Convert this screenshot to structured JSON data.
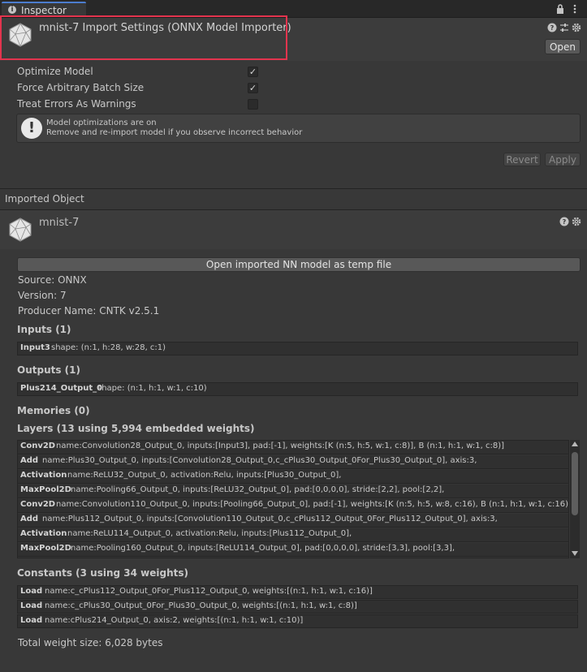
{
  "tab": {
    "label": "Inspector",
    "icon": "info-icon"
  },
  "header": {
    "title": "mnist-7 Import Settings (ONNX Model Importer)",
    "open_label": "Open"
  },
  "settings": [
    {
      "label": "Optimize Model",
      "checked": true
    },
    {
      "label": "Force Arbitrary Batch Size",
      "checked": true
    },
    {
      "label": "Treat Errors As Warnings",
      "checked": false
    }
  ],
  "help": {
    "line1": "Model optimizations are on",
    "line2": "Remove and re-import model if you observe incorrect behavior"
  },
  "revert_label": "Revert",
  "apply_label": "Apply",
  "imported_object_label": "Imported Object",
  "asset": {
    "title": "mnist-7",
    "open_temp_label": "Open imported NN model as temp file",
    "source": "Source: ONNX",
    "version": "Version: 7",
    "producer": "Producer Name: CNTK v2.5.1"
  },
  "inputs": {
    "title": "Inputs (1)",
    "items": [
      {
        "name": "Input3",
        "desc": "shape: (n:1, h:28, w:28, c:1)"
      }
    ]
  },
  "outputs": {
    "title": "Outputs (1)",
    "items": [
      {
        "name": "Plus214_Output_0",
        "desc": "shape: (n:1, h:1, w:1, c:10)"
      }
    ]
  },
  "memories": {
    "title": "Memories (0)"
  },
  "layers": {
    "title": "Layers (13 using 5,994 embedded weights)",
    "items": [
      {
        "name": "Conv2D",
        "desc": "name:Convolution28_Output_0, inputs:[Input3], pad:[-1], weights:[K (n:5, h:5, w:1, c:8)], B (n:1, h:1, w:1, c:8)]"
      },
      {
        "name": "Add",
        "desc": "name:Plus30_Output_0, inputs:[Convolution28_Output_0,c_cPlus30_Output_0For_Plus30_Output_0], axis:3,"
      },
      {
        "name": "Activation",
        "desc": "name:ReLU32_Output_0, activation:Relu, inputs:[Plus30_Output_0],"
      },
      {
        "name": "MaxPool2D",
        "desc": "name:Pooling66_Output_0, inputs:[ReLU32_Output_0], pad:[0,0,0,0], stride:[2,2], pool:[2,2],"
      },
      {
        "name": "Conv2D",
        "desc": "name:Convolution110_Output_0, inputs:[Pooling66_Output_0], pad:[-1], weights:[K (n:5, h:5, w:8, c:16), B (n:1, h:1, w:1, c:16)]"
      },
      {
        "name": "Add",
        "desc": "name:Plus112_Output_0, inputs:[Convolution110_Output_0,c_cPlus112_Output_0For_Plus112_Output_0], axis:3,"
      },
      {
        "name": "Activation",
        "desc": "name:ReLU114_Output_0, activation:Relu, inputs:[Plus112_Output_0],"
      },
      {
        "name": "MaxPool2D",
        "desc": "name:Pooling160_Output_0, inputs:[ReLU114_Output_0], pad:[0,0,0,0], stride:[3,3], pool:[3,3],"
      }
    ]
  },
  "constants": {
    "title": "Constants (3 using 34 weights)",
    "items": [
      {
        "name": "Load",
        "desc": "name:c_cPlus112_Output_0For_Plus112_Output_0, weights:[(n:1, h:1, w:1, c:16)]"
      },
      {
        "name": "Load",
        "desc": "name:c_cPlus30_Output_0For_Plus30_Output_0, weights:[(n:1, h:1, w:1, c:8)]"
      },
      {
        "name": "Load",
        "desc": "name:cPlus214_Output_0, axis:2, weights:[(n:1, h:1, w:1, c:10)]"
      }
    ]
  },
  "total_weight": "Total weight size: 6,028 bytes",
  "colors": {
    "accent": "#4c7dce",
    "highlight": "#e3344e"
  }
}
